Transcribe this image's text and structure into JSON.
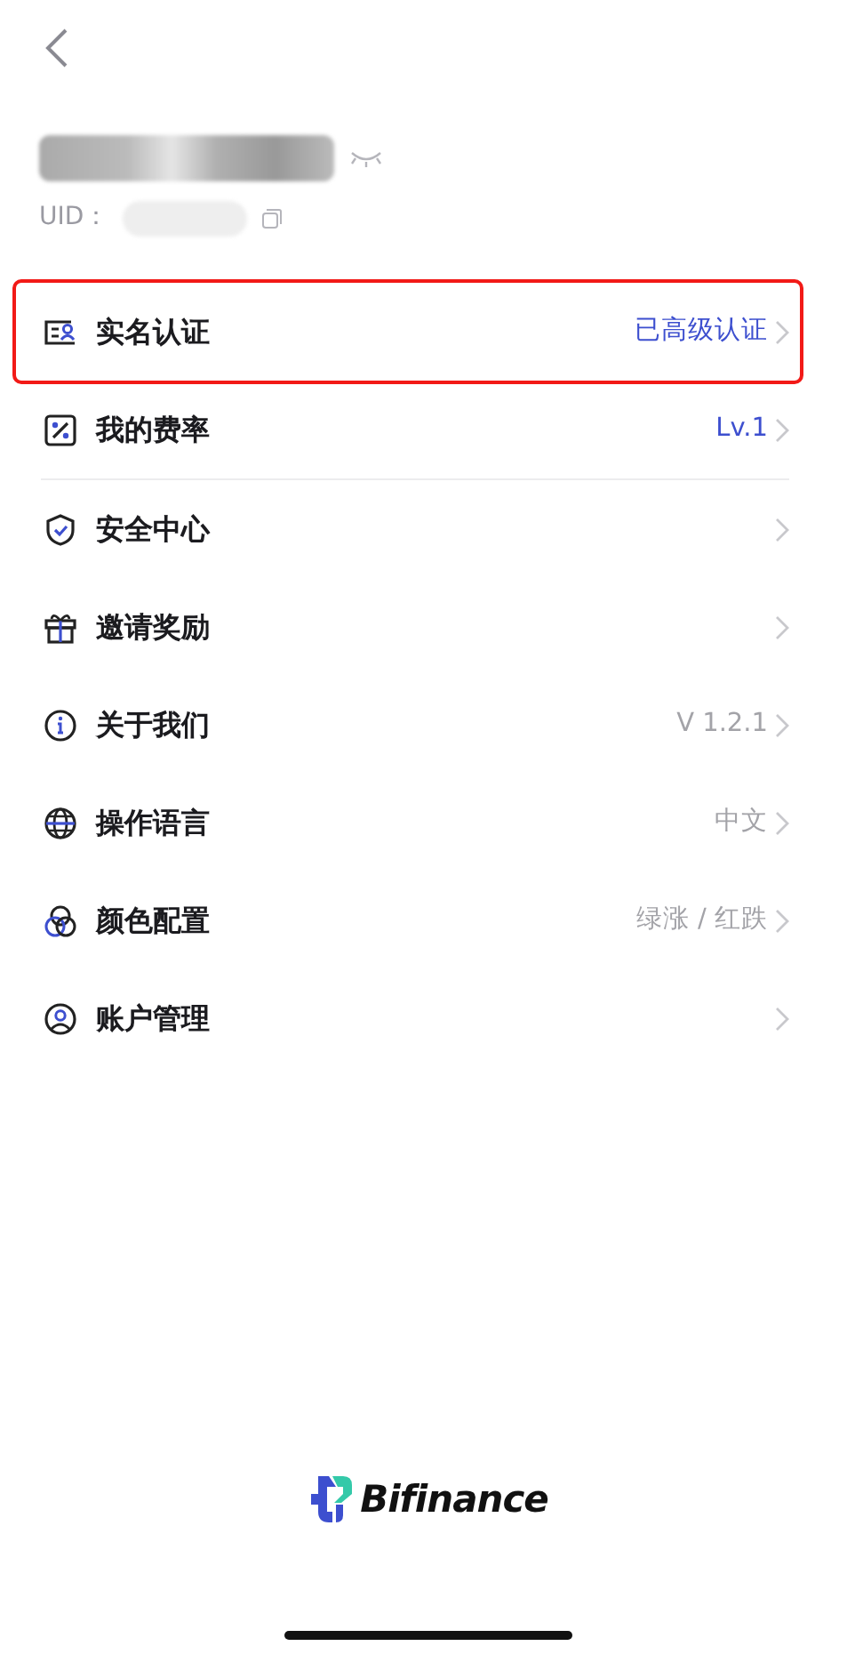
{
  "profile": {
    "uid_label": "UID："
  },
  "menu": [
    {
      "label": "实名认证",
      "value": "已高级认证",
      "accent": true,
      "highlighted": true
    },
    {
      "label": "我的费率",
      "value": "Lv.1",
      "accent": true,
      "highlighted": false,
      "divider": true
    },
    {
      "label": "安全中心",
      "highlighted": false
    },
    {
      "label": "邀请奖励",
      "highlighted": false
    },
    {
      "label": "关于我们",
      "value": "V 1.2.1",
      "accent": false,
      "highlighted": false
    },
    {
      "label": "操作语言",
      "value": "中文",
      "accent": false,
      "highlighted": false
    },
    {
      "label": "颜色配置",
      "value": "绿涨 / 红跌",
      "accent": false,
      "highlighted": false
    },
    {
      "label": "账户管理",
      "highlighted": false
    }
  ],
  "footer": {
    "brand": "Bifinance"
  }
}
